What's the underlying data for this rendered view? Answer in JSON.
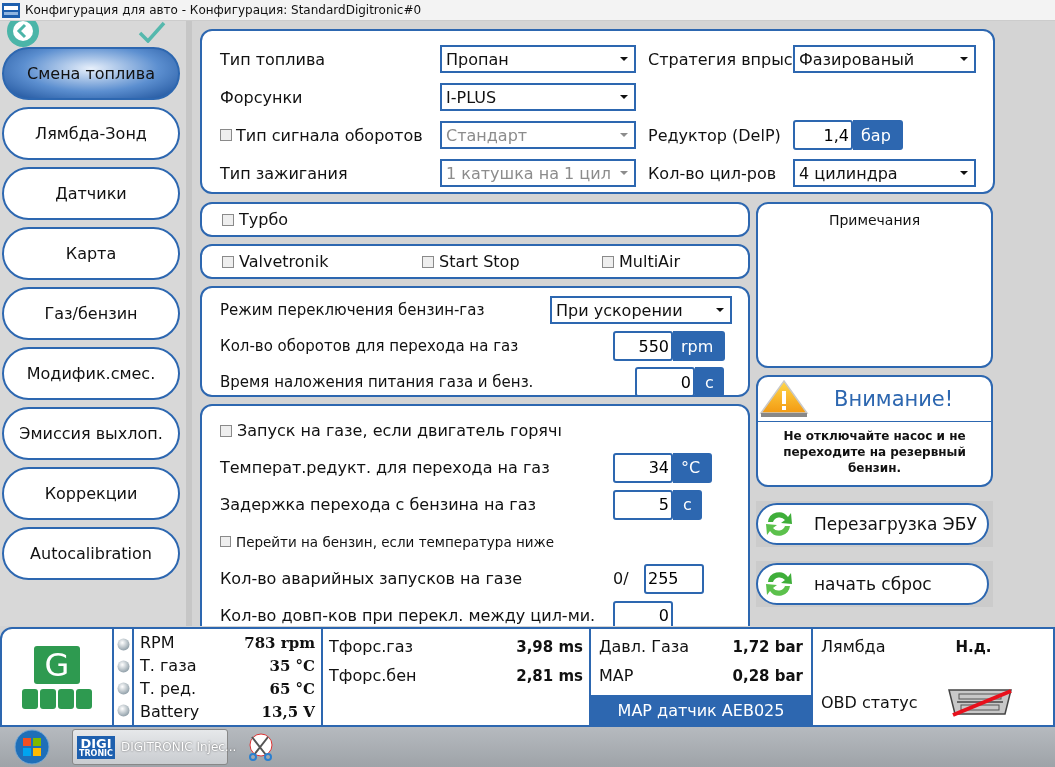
{
  "window": {
    "title": "Конфигурация для авто - Конфигурация: StandardDigitronic#0"
  },
  "sidebar": {
    "items": [
      {
        "label": "Смена топлива",
        "selected": true
      },
      {
        "label": "Лямбда-Зонд",
        "selected": false
      },
      {
        "label": "Датчики",
        "selected": false
      },
      {
        "label": "Карта",
        "selected": false
      },
      {
        "label": "Газ/бензин",
        "selected": false
      },
      {
        "label": "Модифик.смес.",
        "selected": false
      },
      {
        "label": "Эмиссия выхлоп.",
        "selected": false
      },
      {
        "label": "Коррекции",
        "selected": false
      },
      {
        "label": "Autocalibration",
        "selected": false
      }
    ]
  },
  "fuel_panel": {
    "left": [
      {
        "kind": "select",
        "label": "Тип топлива",
        "value": "Пропан",
        "disabled": false
      },
      {
        "kind": "select",
        "label": "Форсунки",
        "value": "I-PLUS",
        "disabled": false
      },
      {
        "kind": "select",
        "label": "Тип сигнала оборотов",
        "value": "Стандарт",
        "disabled": true,
        "checked": false
      },
      {
        "kind": "select",
        "label": "Тип зажигания",
        "value": "1 катушка на 1 цил",
        "disabled": true
      }
    ],
    "right": [
      {
        "kind": "select",
        "label": "Стратегия впрыс",
        "value": "Фазированый",
        "disabled": false
      },
      {
        "kind": "unit",
        "label": "Редуктор (DelP)",
        "value": "1,4",
        "unit": "бар"
      },
      {
        "kind": "select",
        "label": "Кол-во цил-ров",
        "value": "4 цилиндра",
        "disabled": false
      }
    ]
  },
  "turbo_panel": {
    "options": [
      {
        "label": "Турбо",
        "checked": false
      }
    ]
  },
  "engine_panel": {
    "options": [
      {
        "label": "Valvetronik",
        "checked": false
      },
      {
        "label": "Start  Stop",
        "checked": false
      },
      {
        "label": "MultiAir",
        "checked": false
      }
    ]
  },
  "switch_panel": {
    "rows": [
      {
        "kind": "select",
        "label": "Режим переключения бензин-газ",
        "value": "При ускорении",
        "disabled": false
      },
      {
        "kind": "unit",
        "label": "Кол-во оборотов для перехода на газ",
        "value": "550",
        "unit": "rpm"
      },
      {
        "kind": "unit",
        "label": "Время наложения питания газа и бенз.",
        "value": "0",
        "unit": "с"
      }
    ]
  },
  "start_panel": {
    "rows": [
      {
        "kind": "check",
        "label": "Запуск на газе, если двигатель горячı",
        "checked": false
      },
      {
        "kind": "unit",
        "label": "Температ.редукт. для перехода на газ",
        "value": "34",
        "unit": "°C"
      },
      {
        "kind": "unit",
        "label": "Задержка перехода с бензина на газ",
        "value": "5",
        "unit": "с"
      },
      {
        "kind": "smallcheck",
        "label": "Перейти на бензин, если температура ниже",
        "checked": false
      },
      {
        "kind": "count",
        "label": "Кол-во аварийных запусков на газе",
        "prefix": "0/",
        "value": "255"
      },
      {
        "kind": "number",
        "label": "Кол-во довп-ков при перекл. между цил-ми.",
        "value": "0"
      }
    ]
  },
  "notes": {
    "title": "Примечания"
  },
  "warning": {
    "title": "Внимание!",
    "text": "Не отключайте насос и не переходите на резервный бензин."
  },
  "actions": [
    "Перезагрузка ЭБУ",
    "начать сброс"
  ],
  "status_bar": {
    "fuel_indicator": "G",
    "readings": [
      {
        "label": "RPM",
        "value": "783 rpm"
      },
      {
        "label": "Т. газа",
        "value": "35 °C"
      },
      {
        "label": "Т. ред.",
        "value": "65 °C"
      },
      {
        "label": "Battery",
        "value": "13,5 V"
      }
    ],
    "injection": [
      {
        "label": "Тфорс.газ",
        "value": "3,98 ms"
      },
      {
        "label": "Тфорс.бен",
        "value": "2,81 ms"
      }
    ],
    "pressure": [
      {
        "label": "Давл. Газа",
        "value": "1,72 bar"
      },
      {
        "label": "MAP",
        "value": "0,28 bar"
      }
    ],
    "map_sensor": "MAP датчик AEB025",
    "lambda": {
      "label": "Лямбда",
      "value": "Н.д."
    },
    "obd": {
      "label": "OBD статус"
    }
  },
  "taskbar": {
    "app": {
      "logo_top": "DIGI",
      "logo_bottom": "TRONIC",
      "label": "DIGITRONIC Injec..."
    }
  }
}
